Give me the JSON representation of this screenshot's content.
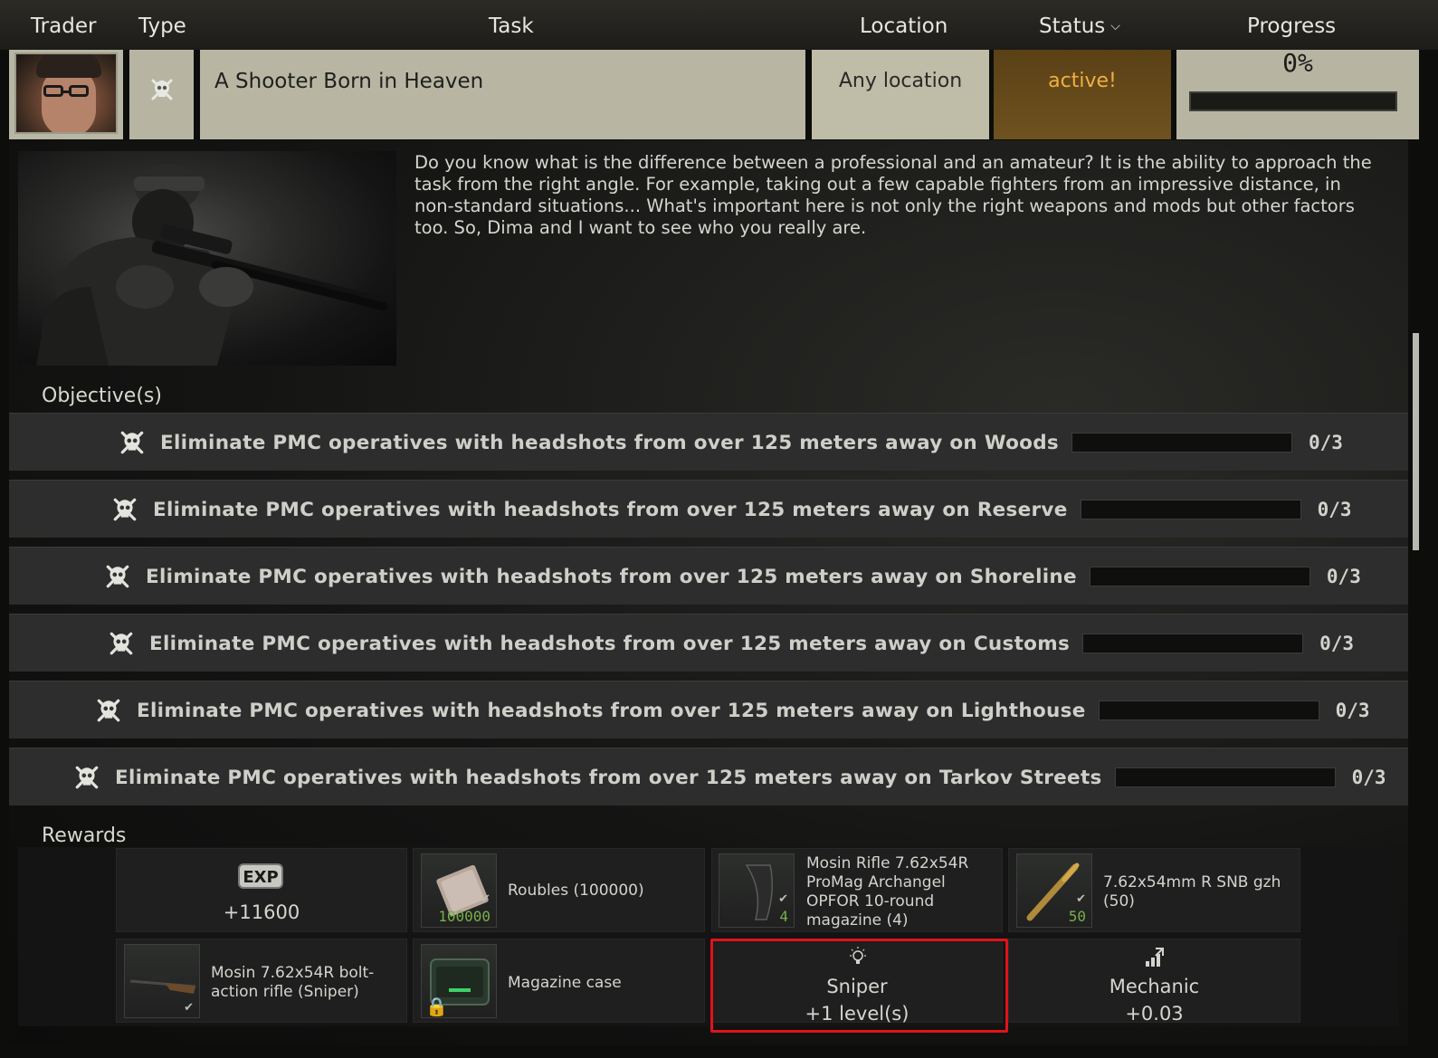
{
  "header": {
    "trader": "Trader",
    "type": "Type",
    "task": "Task",
    "location": "Location",
    "status": "Status",
    "progress": "Progress"
  },
  "quest": {
    "name": "A Shooter Born in Heaven",
    "location": "Any location",
    "status": "active!",
    "progress_text": "0%",
    "progress_value": 0,
    "type_icon": "skull-crossbones-icon",
    "status_color": "#f0b040",
    "description": "Do you know what is the difference between a professional and an amateur? It is the ability to approach the task from the right angle. For example, taking out a few capable fighters from an impressive distance, in non-standard situations... What's important here is not only the right weapons and mods but other factors too. So, Dima and I want to see who you really are."
  },
  "labels": {
    "objectives": "Objective(s)",
    "rewards": "Rewards"
  },
  "objectives": [
    {
      "text": "Eliminate PMC operatives with headshots from over 125 meters away on Woods",
      "count": "0/3",
      "progress": 0
    },
    {
      "text": "Eliminate PMC operatives with headshots from over 125 meters away on Reserve",
      "count": "0/3",
      "progress": 0
    },
    {
      "text": "Eliminate PMC operatives with headshots from over 125 meters away on Shoreline",
      "count": "0/3",
      "progress": 0
    },
    {
      "text": "Eliminate PMC operatives with headshots from over 125 meters away on Customs",
      "count": "0/3",
      "progress": 0
    },
    {
      "text": "Eliminate PMC operatives with headshots from over 125 meters away on Lighthouse",
      "count": "0/3",
      "progress": 0
    },
    {
      "text": "Eliminate PMC operatives with headshots from over 125 meters away on Tarkov Streets",
      "count": "0/3",
      "progress": 0
    }
  ],
  "rewards": {
    "exp_badge": "EXP",
    "exp_value": "+11600",
    "roubles_label": "Roubles (100000)",
    "roubles_count": "100000",
    "magazine_label": "Mosin Rifle 7.62x54R ProMag Archangel OPFOR 10-round magazine (4)",
    "magazine_count": "4",
    "ammo_label": "7.62x54mm R SNB gzh (50)",
    "ammo_count": "50",
    "rifle_label": "Mosin 7.62x54R bolt-action rifle (Sniper)",
    "case_label": "Magazine case",
    "skill_name": "Sniper",
    "skill_value": "+1 level(s)",
    "trader_name": "Mechanic",
    "trader_value": "+0.03"
  }
}
